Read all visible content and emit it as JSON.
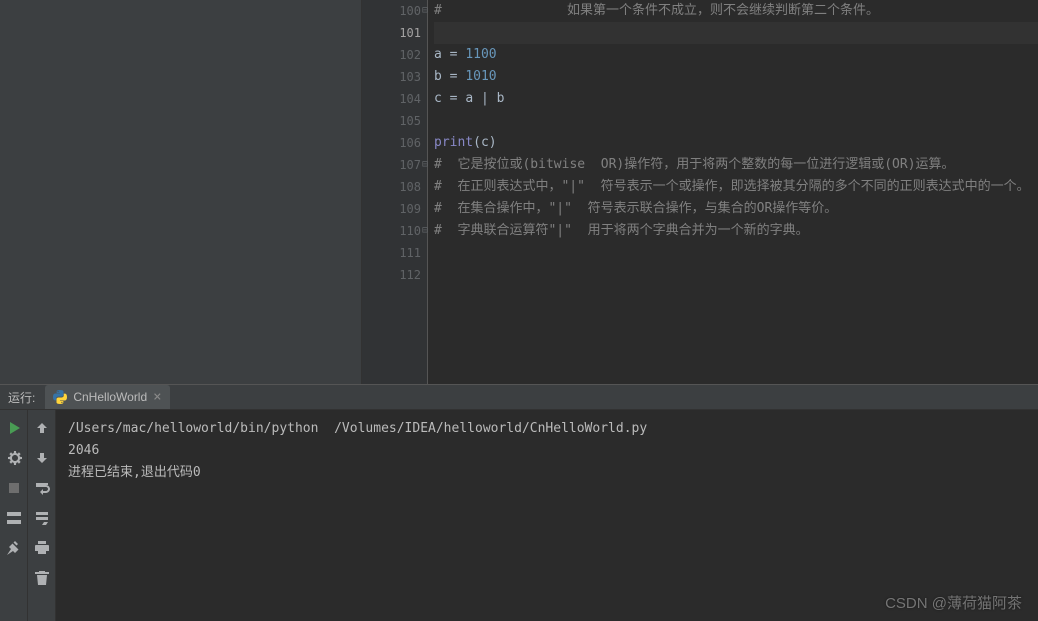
{
  "editor": {
    "lines": [
      {
        "num": "100",
        "active": false,
        "tokens": [
          {
            "cls": "tk-comment",
            "t": "#                如果第一个条件不成立，则不会继续判断第二个条件。"
          }
        ],
        "fold": true
      },
      {
        "num": "101",
        "active": true,
        "tokens": []
      },
      {
        "num": "102",
        "active": false,
        "tokens": [
          {
            "cls": "tk-var",
            "t": "a "
          },
          {
            "cls": "tk-op",
            "t": "= "
          },
          {
            "cls": "tk-number",
            "t": "1100"
          }
        ]
      },
      {
        "num": "103",
        "active": false,
        "tokens": [
          {
            "cls": "tk-var",
            "t": "b "
          },
          {
            "cls": "tk-op",
            "t": "= "
          },
          {
            "cls": "tk-number",
            "t": "1010"
          }
        ]
      },
      {
        "num": "104",
        "active": false,
        "tokens": [
          {
            "cls": "tk-var",
            "t": "c "
          },
          {
            "cls": "tk-op",
            "t": "= "
          },
          {
            "cls": "tk-var",
            "t": "a "
          },
          {
            "cls": "tk-op",
            "t": "| "
          },
          {
            "cls": "tk-var",
            "t": "b"
          }
        ]
      },
      {
        "num": "105",
        "active": false,
        "tokens": []
      },
      {
        "num": "106",
        "active": false,
        "tokens": [
          {
            "cls": "tk-func",
            "t": "print"
          },
          {
            "cls": "tk-paren",
            "t": "("
          },
          {
            "cls": "tk-var",
            "t": "c"
          },
          {
            "cls": "tk-paren",
            "t": ")"
          }
        ]
      },
      {
        "num": "107",
        "active": false,
        "tokens": [
          {
            "cls": "tk-comment",
            "t": "#  它是按位或(bitwise  OR)操作符，用于将两个整数的每一位进行逻辑或(OR)运算。"
          }
        ],
        "fold": true
      },
      {
        "num": "108",
        "active": false,
        "tokens": [
          {
            "cls": "tk-comment",
            "t": "#  在正则表达式中，\"|\"  符号表示一个或操作，即选择被其分隔的多个不同的正则表达式中的一个。"
          }
        ]
      },
      {
        "num": "109",
        "active": false,
        "tokens": [
          {
            "cls": "tk-comment",
            "t": "#  在集合操作中，\"|\"  符号表示联合操作，与集合的OR操作等价。"
          }
        ]
      },
      {
        "num": "110",
        "active": false,
        "tokens": [
          {
            "cls": "tk-comment",
            "t": "#  字典联合运算符\"|\"  用于将两个字典合并为一个新的字典。"
          }
        ],
        "fold": true
      },
      {
        "num": "111",
        "active": false,
        "tokens": []
      },
      {
        "num": "112",
        "active": false,
        "tokens": []
      }
    ]
  },
  "run": {
    "label": "运行:",
    "tab_name": "CnHelloWorld"
  },
  "console": {
    "lines": [
      "/Users/mac/helloworld/bin/python  /Volumes/IDEA/helloworld/CnHelloWorld.py",
      "2046",
      "",
      "进程已结束,退出代码0"
    ]
  },
  "watermark": "CSDN @薄荷猫阿茶"
}
